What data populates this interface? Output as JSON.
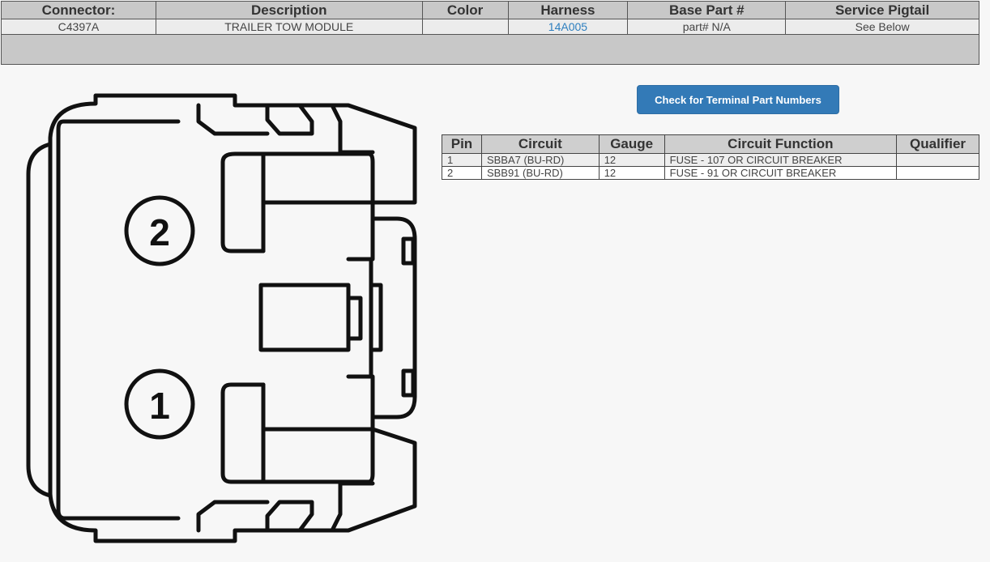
{
  "header": {
    "columns": [
      "Connector:",
      "Description",
      "Color",
      "Harness",
      "Base Part #",
      "Service Pigtail"
    ],
    "row": {
      "connector": "C4397A",
      "description": "TRAILER TOW MODULE",
      "color": "",
      "harness": "14A005",
      "base_part": "part# N/A",
      "service_pigtail": "See Below"
    }
  },
  "button": {
    "label": "Check for Terminal Part Numbers"
  },
  "pin_table": {
    "columns": [
      "Pin",
      "Circuit",
      "Gauge",
      "Circuit Function",
      "Qualifier"
    ],
    "rows": [
      {
        "pin": "1",
        "circuit": "SBBA7 (BU-RD)",
        "gauge": "12",
        "function": "FUSE - 107 OR CIRCUIT BREAKER",
        "qualifier": ""
      },
      {
        "pin": "2",
        "circuit": "SBB91 (BU-RD)",
        "gauge": "12",
        "function": "FUSE - 91 OR CIRCUIT BREAKER",
        "qualifier": ""
      }
    ]
  },
  "diagram": {
    "pin_labels": [
      "2",
      "1"
    ]
  }
}
